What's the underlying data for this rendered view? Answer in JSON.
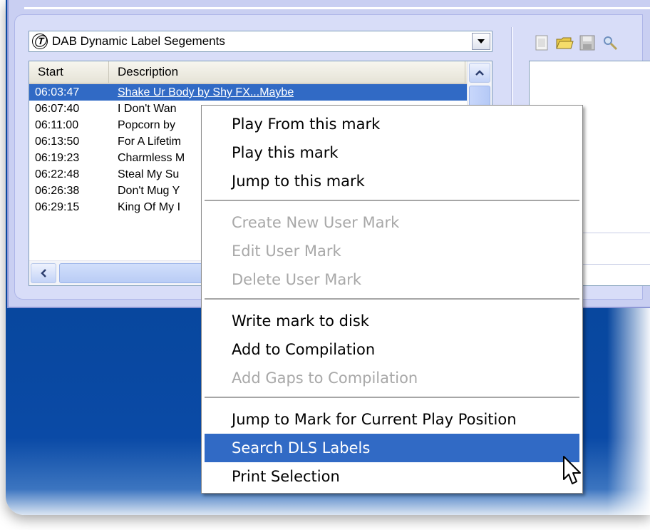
{
  "combo": {
    "icon": "Ⓣ",
    "icon_name": "text-logo-icon",
    "value": "DAB Dynamic Label Segements"
  },
  "list": {
    "columns": [
      "Start",
      "Description"
    ],
    "rows": [
      {
        "start": "06:03:47",
        "desc": "Shake Ur Body by Shy FX...Maybe",
        "selected": true
      },
      {
        "start": "06:07:40",
        "desc": "I Don't Wan",
        "selected": false
      },
      {
        "start": "06:11:00",
        "desc": "Popcorn by",
        "selected": false
      },
      {
        "start": "06:13:50",
        "desc": "For A Lifetim",
        "selected": false
      },
      {
        "start": "06:19:23",
        "desc": "Charmless M",
        "selected": false
      },
      {
        "start": "06:22:48",
        "desc": "Steal My Su",
        "selected": false
      },
      {
        "start": "06:26:38",
        "desc": "Don't Mug Y",
        "selected": false
      },
      {
        "start": "06:29:15",
        "desc": "King Of My I",
        "selected": false
      }
    ]
  },
  "toolbar": {
    "icons": [
      "new-icon",
      "open-folder-icon",
      "save-icon",
      "search-icon"
    ]
  },
  "menu": {
    "groups": [
      [
        {
          "label": "Play From this mark",
          "enabled": true
        },
        {
          "label": "Play this mark",
          "enabled": true
        },
        {
          "label": "Jump to this mark",
          "enabled": true
        }
      ],
      [
        {
          "label": "Create New User Mark",
          "enabled": false
        },
        {
          "label": "Edit User Mark",
          "enabled": false
        },
        {
          "label": "Delete User Mark",
          "enabled": false
        }
      ],
      [
        {
          "label": "Write mark to disk",
          "enabled": true
        },
        {
          "label": "Add to Compilation",
          "enabled": true
        },
        {
          "label": "Add Gaps to Compilation",
          "enabled": false
        }
      ],
      [
        {
          "label": "Jump to Mark for Current Play Position",
          "enabled": true
        },
        {
          "label": "Search DLS Labels",
          "enabled": true,
          "hover": true
        },
        {
          "label": "Print Selection",
          "enabled": true
        }
      ]
    ]
  },
  "colors": {
    "selection": "#316ac5",
    "disabled_text": "#a8a8a8",
    "desktop": "#0b4aa0",
    "panel": "#d8ddf8"
  }
}
